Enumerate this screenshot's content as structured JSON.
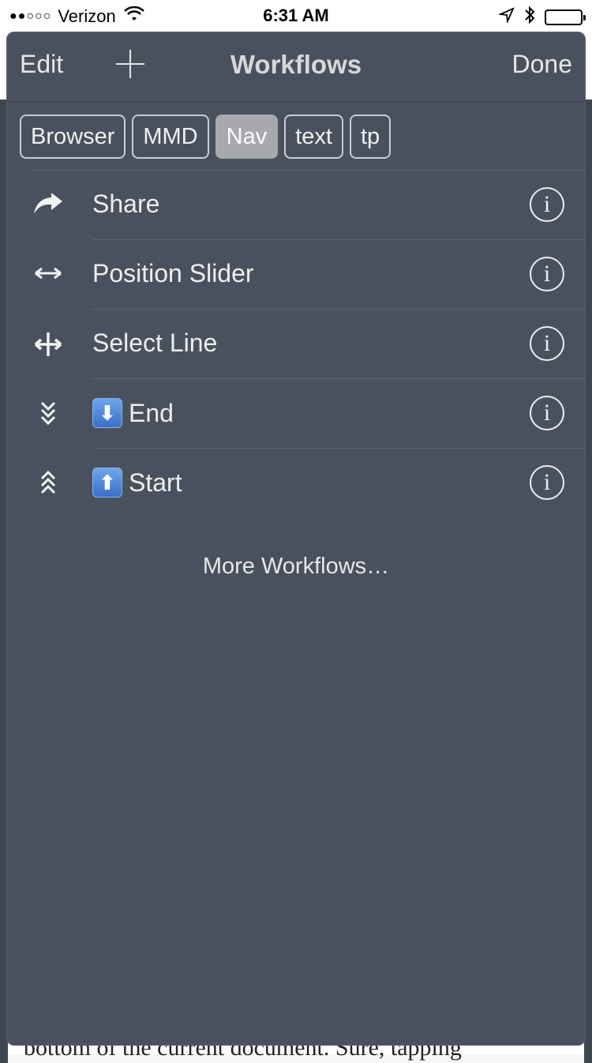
{
  "status_bar": {
    "signal": "●●○○○",
    "carrier": "Verizon",
    "time": "6:31 AM"
  },
  "nav": {
    "edit_label": "Edit",
    "title": "Workflows",
    "done_label": "Done"
  },
  "tags": [
    "Browser",
    "MMD",
    "Nav",
    "text",
    "tp"
  ],
  "active_tag": "Nav",
  "workflows": [
    {
      "icon": "share-arrow-icon",
      "emoji": "",
      "label": "Share"
    },
    {
      "icon": "double-arrow-icon",
      "emoji": "",
      "label": "Position Slider"
    },
    {
      "icon": "move-cross-icon",
      "emoji": "",
      "label": "Select Line"
    },
    {
      "icon": "chevrons-down-icon",
      "emoji": "down-arrow-emoji",
      "label": "End"
    },
    {
      "icon": "chevrons-up-icon",
      "emoji": "up-arrow-emoji",
      "label": "Start"
    }
  ],
  "more_label": "More Workflows…",
  "background_text": "bottom of the current document. Sure, tapping"
}
